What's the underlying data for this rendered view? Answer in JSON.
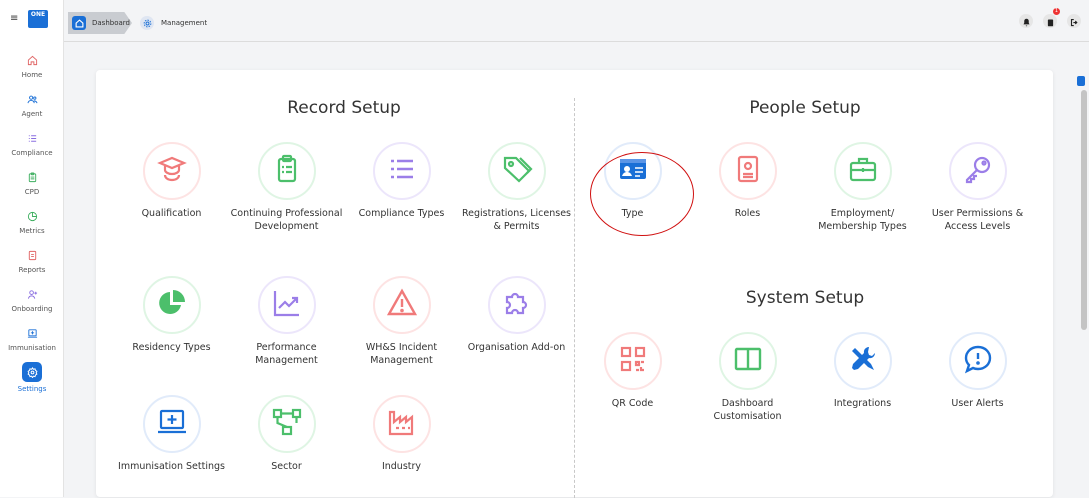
{
  "app": {
    "logo_text": "ONE"
  },
  "breadcrumb": {
    "items": [
      "Dashboard",
      "Management"
    ]
  },
  "topbar": {
    "notification_badge": "1"
  },
  "sidebar": {
    "items": [
      {
        "label": "Home",
        "icon": "home-icon"
      },
      {
        "label": "Agent",
        "icon": "users-icon"
      },
      {
        "label": "Compliance",
        "icon": "list-icon"
      },
      {
        "label": "CPD",
        "icon": "clipboard-icon"
      },
      {
        "label": "Metrics",
        "icon": "pie-chart-icon"
      },
      {
        "label": "Reports",
        "icon": "report-icon"
      },
      {
        "label": "Onboarding",
        "icon": "user-plus-icon"
      },
      {
        "label": "Immunisation",
        "icon": "medical-monitor-icon"
      },
      {
        "label": "Settings",
        "icon": "gear-icon",
        "active": true
      }
    ]
  },
  "record_setup": {
    "title": "Record Setup",
    "tiles": [
      {
        "label": "Qualification",
        "icon": "graduate-icon",
        "color": "#f07a7a"
      },
      {
        "label": "Continuing Professional Development",
        "icon": "clipboard-icon",
        "color": "#4cbf6b"
      },
      {
        "label": "Compliance Types",
        "icon": "list-icon",
        "color": "#9b7ee8"
      },
      {
        "label": "Registrations, Licenses & Permits",
        "icon": "tag-icon",
        "color": "#4cbf6b"
      },
      {
        "label": "Residency Types",
        "icon": "pie-chart-icon",
        "color": "#4cbf6b"
      },
      {
        "label": "Performance Management",
        "icon": "trend-chart-icon",
        "color": "#9b7ee8"
      },
      {
        "label": "WH&S Incident Management",
        "icon": "warning-icon",
        "color": "#f07a7a"
      },
      {
        "label": "Organisation Add-on",
        "icon": "puzzle-icon",
        "color": "#9b7ee8"
      },
      {
        "label": "Immunisation Settings",
        "icon": "medical-monitor-icon",
        "color": "#1a6fd6"
      },
      {
        "label": "Sector",
        "icon": "sector-icon",
        "color": "#4cbf6b"
      },
      {
        "label": "Industry",
        "icon": "factory-icon",
        "color": "#f07a7a"
      }
    ]
  },
  "people_setup": {
    "title": "People Setup",
    "tiles": [
      {
        "label": "Type",
        "icon": "id-card-icon",
        "color": "#1a6fd6"
      },
      {
        "label": "Roles",
        "icon": "badge-icon",
        "color": "#f07a7a"
      },
      {
        "label": "Employment/ Membership Types",
        "icon": "briefcase-icon",
        "color": "#4cbf6b"
      },
      {
        "label": "User Permissions & Access Levels",
        "icon": "key-icon",
        "color": "#9b7ee8"
      }
    ]
  },
  "system_setup": {
    "title": "System Setup",
    "tiles": [
      {
        "label": "QR Code",
        "icon": "qr-code-icon",
        "color": "#f07a7a"
      },
      {
        "label": "Dashboard Customisation",
        "icon": "columns-icon",
        "color": "#4cbf6b"
      },
      {
        "label": "Integrations",
        "icon": "tools-icon",
        "color": "#1a6fd6"
      },
      {
        "label": "User Alerts",
        "icon": "alert-bubble-icon",
        "color": "#1a6fd6"
      }
    ]
  }
}
